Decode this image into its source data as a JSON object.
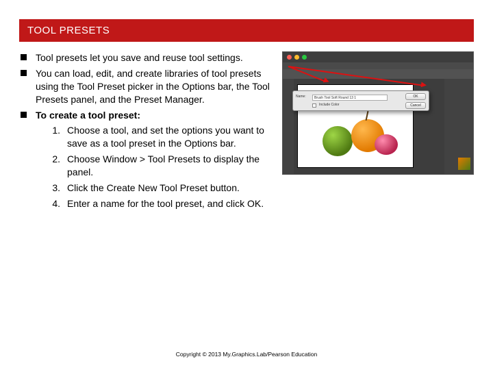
{
  "title": "TOOL PRESETS",
  "bullets": {
    "b1": "Tool presets let you save and reuse tool settings.",
    "b2": "You can load, edit, and create libraries of tool presets using the Tool Preset picker in the Options bar, the Tool Presets panel, and the Preset Manager.",
    "b3": "To create a tool preset:"
  },
  "steps": {
    "n1": "1.",
    "n2": "2.",
    "n3": "3.",
    "n4": "4.",
    "s1": "Choose a tool, and set the options you want to save as a tool preset in the Options bar.",
    "s2": "Choose Window > Tool Presets to display the panel.",
    "s3": "Click the Create New Tool Preset button.",
    "s4": "Enter a name for the tool preset, and click OK."
  },
  "dialog": {
    "nameLabel": "Name:",
    "nameValue": "Brush Tool Soft Round 13 1",
    "includeColor": "Include Color",
    "ok": "OK",
    "cancel": "Cancel"
  },
  "footer": "Copyright © 2013 My.Graphics.Lab/Pearson Education"
}
